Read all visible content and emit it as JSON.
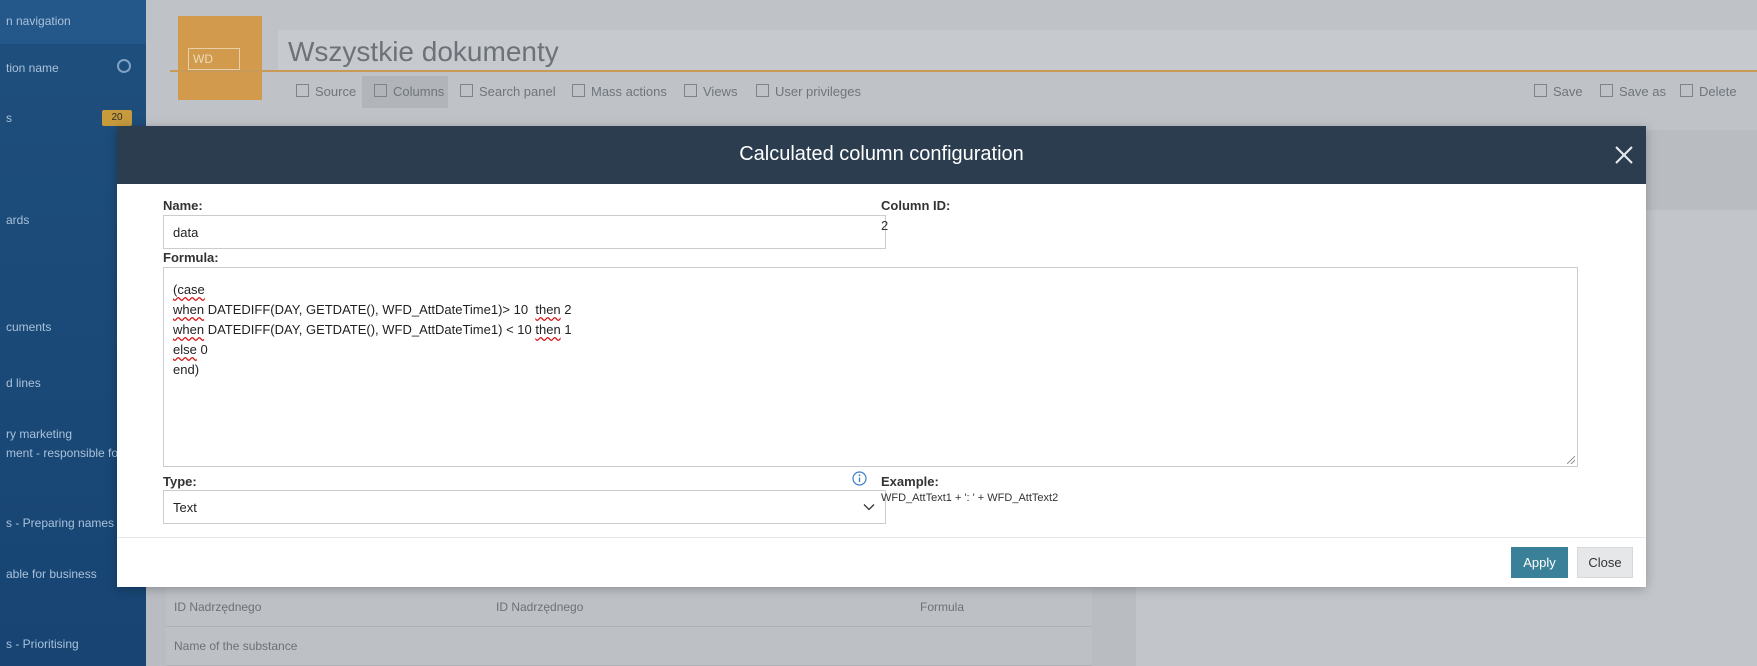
{
  "background": {
    "sidebar_items": [
      "n navigation",
      "tion name",
      "s",
      "ards",
      "cuments",
      "d lines",
      "ry marketing",
      "ment - responsible for",
      "s - Preparing names",
      "able for business",
      "s - Prioritising"
    ],
    "sidebar_badge": "20",
    "page_title": "Wszystkie dokumenty",
    "logo_text": "WD",
    "toolbar": [
      "Source",
      "Columns",
      "Search panel",
      "Mass actions",
      "Views",
      "User privileges"
    ],
    "toolbar_right": [
      "Save",
      "Save as",
      "Delete"
    ],
    "rows": [
      {
        "name": "ID Nadrzędnego",
        "value": "ID Nadrzędnego",
        "badge": "Formula"
      },
      {
        "name": "Name of the substance",
        "value": "",
        "badge": ""
      }
    ]
  },
  "dialog": {
    "title": "Calculated column configuration",
    "name_label": "Name:",
    "name_value": "data",
    "column_id_label": "Column ID:",
    "column_id_value": "2",
    "formula_label": "Formula:",
    "formula_lines": [
      "(case",
      "when DATEDIFF(DAY, GETDATE(), WFD_AttDateTime1)> 10  then 2",
      "when DATEDIFF(DAY, GETDATE(), WFD_AttDateTime1) < 10 then 1",
      "else 0",
      "end)"
    ],
    "type_label": "Type:",
    "type_value": "Text",
    "example_label": "Example:",
    "example_value": "WFD_AttText1 + ': ' + WFD_AttText2",
    "apply_label": "Apply",
    "close_label": "Close"
  },
  "colors": {
    "header_bg": "#2b3d4f",
    "apply_bg": "#3a8098",
    "close_bg": "#e6e7e9",
    "accent": "#d19a4c"
  },
  "icons": {
    "close": "close-icon",
    "info": "info-icon",
    "dropdown": "chevron-down-icon"
  }
}
